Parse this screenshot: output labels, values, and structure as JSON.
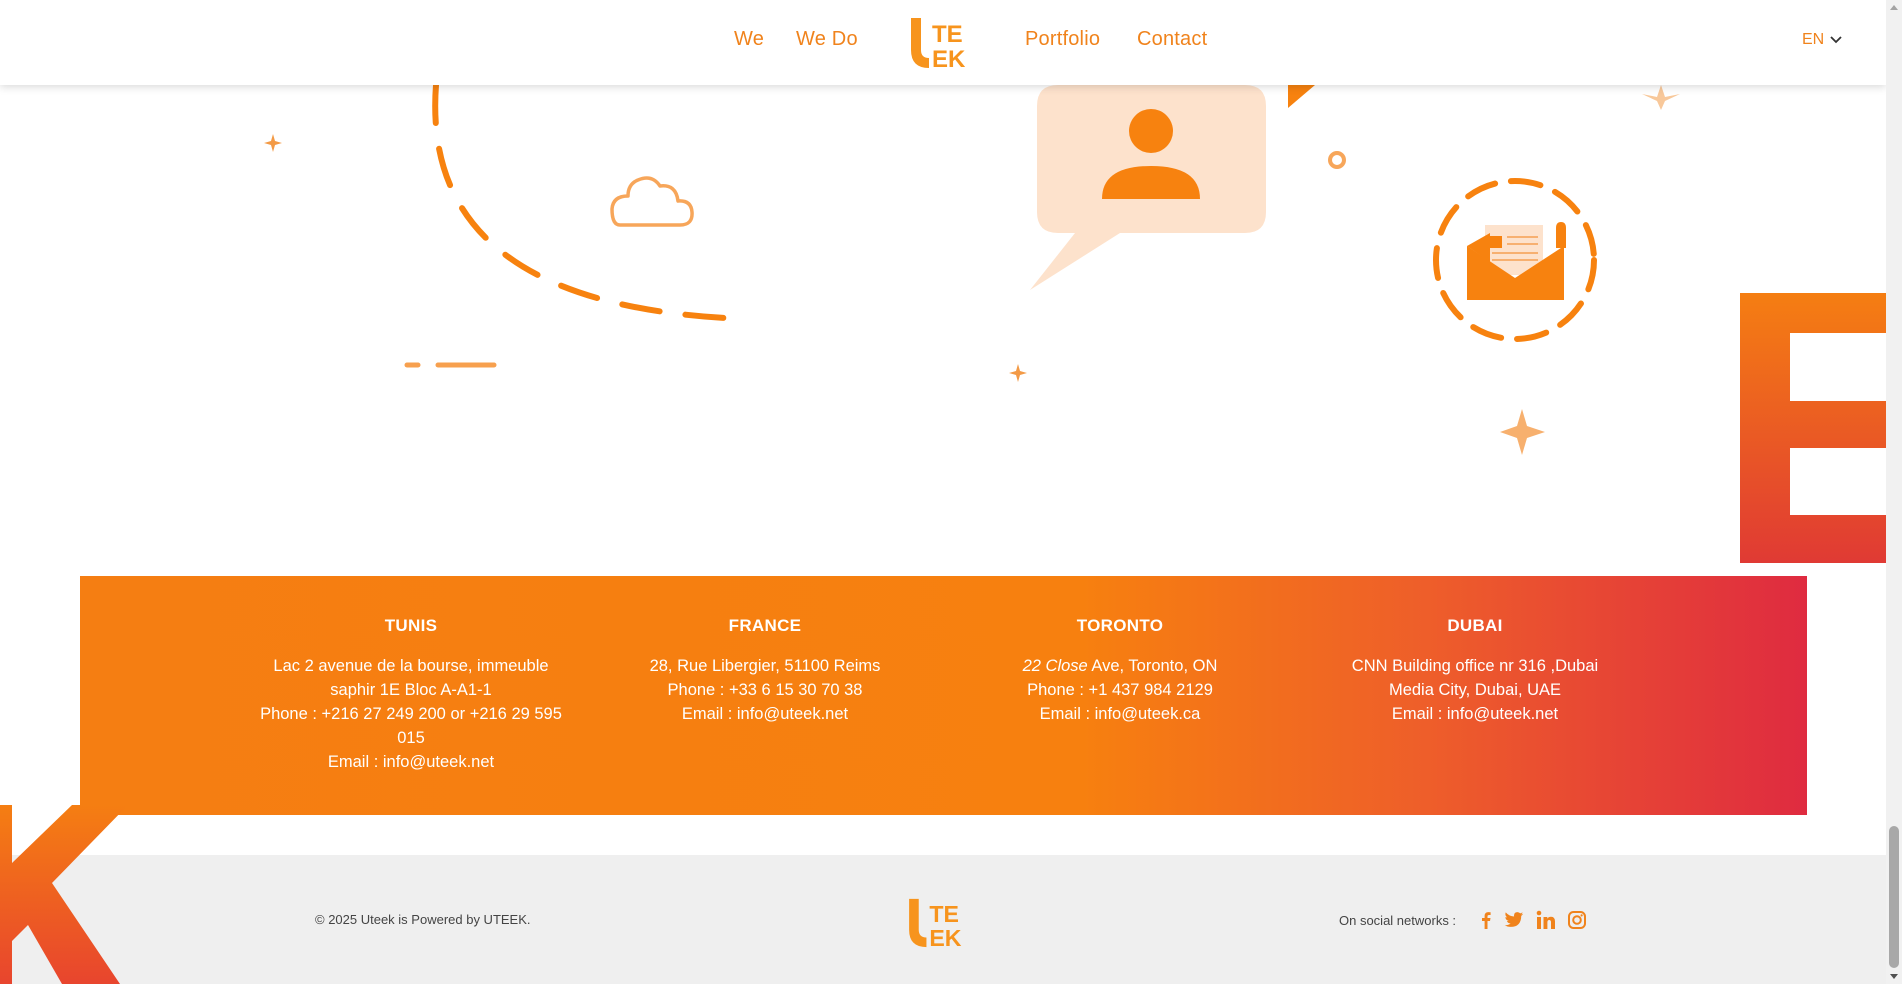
{
  "nav": {
    "links": [
      "We",
      "We Do",
      "Portfolio",
      "Contact"
    ],
    "logo_text_top": "TE",
    "logo_text_bottom": "EK",
    "logo_letter": "U",
    "language": "EN"
  },
  "decor": {
    "big_letter_right": "E",
    "big_letter_left": "K"
  },
  "offices": [
    {
      "city": "TUNIS",
      "lines": [
        "Lac 2 avenue de la bourse, immeuble",
        "saphir 1E Bloc A-A1-1",
        "Phone :  +216 27 249 200 or +216 29 595",
        "015",
        "Email : info@uteek.net"
      ]
    },
    {
      "city": "FRANCE",
      "lines": [
        "28, Rue Libergier, 51100 Reims",
        "Phone : +33 6 15 30 70 38",
        "Email : info@uteek.net"
      ]
    },
    {
      "city": "TORONTO",
      "italic": "22 Close",
      "lines": [
        " Ave, Toronto, ON",
        "Phone : +1 437 984 2129",
        "Email : info@uteek.ca"
      ]
    },
    {
      "city": "DUBAI",
      "lines": [
        "CNN Building office nr 316 ,Dubai",
        "Media City, Dubai, UAE",
        "Email : info@uteek.net"
      ]
    }
  ],
  "footer": {
    "copyright": "© 2025 Uteek is Powered by UTEEK.",
    "social_label": "On social networks :",
    "social_icons": [
      "facebook-icon",
      "twitter-icon",
      "linkedin-icon",
      "instagram-icon"
    ]
  },
  "colors": {
    "brand_orange": "#f0831c",
    "band_start": "#f57e12",
    "band_end": "#df2b40",
    "footer_bg": "#efefef"
  }
}
